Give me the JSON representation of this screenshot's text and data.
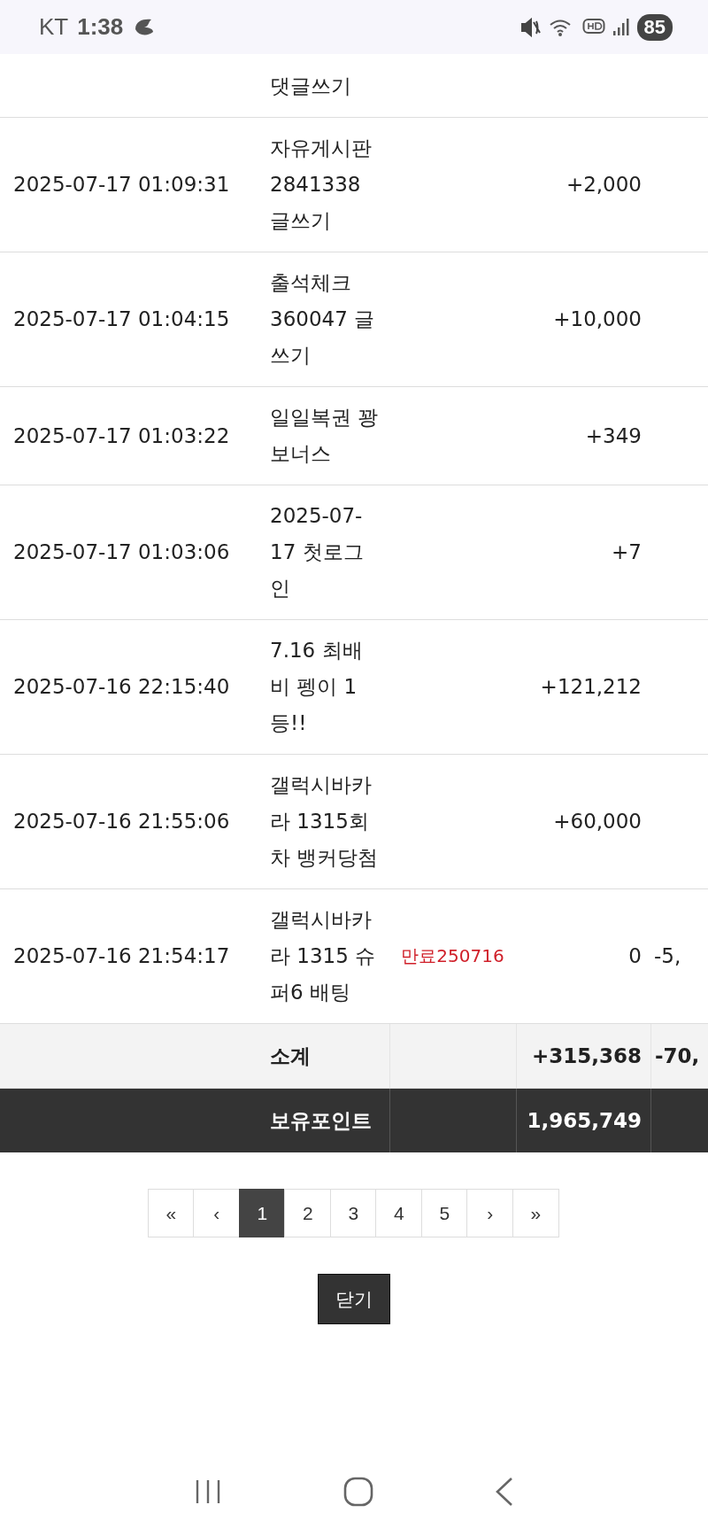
{
  "status_bar": {
    "carrier": "KT",
    "time": "1:38",
    "battery": "85"
  },
  "table": {
    "rows": [
      {
        "date": "",
        "description": "댓글쓰기",
        "memo": "",
        "amount": "",
        "column_5": ""
      },
      {
        "date": "2025-07-17 01:09:31",
        "description": "자유게시판 2841338 글쓰기",
        "memo": "",
        "amount": "+2,000",
        "column_5": ""
      },
      {
        "date": "2025-07-17 01:04:15",
        "description": "출석체크 360047 글쓰기",
        "memo": "",
        "amount": "+10,000",
        "column_5": ""
      },
      {
        "date": "2025-07-17 01:03:22",
        "description": "일일복권 꽝 보너스",
        "memo": "",
        "amount": "+349",
        "column_5": ""
      },
      {
        "date": "2025-07-17 01:03:06",
        "description": "2025-07-17 첫로그인",
        "memo": "",
        "amount": "+7",
        "column_5": ""
      },
      {
        "date": "2025-07-16 22:15:40",
        "description": "7.16 최배비 펭이 1등!!",
        "memo": "",
        "amount": "+121,212",
        "column_5": ""
      },
      {
        "date": "2025-07-16 21:55:06",
        "description": "갤럭시바카라 1315회차 뱅커당첨",
        "memo": "",
        "amount": "+60,000",
        "column_5": ""
      },
      {
        "date": "2025-07-16 21:54:17",
        "description": "갤럭시바카라 1315 슈퍼6 배팅",
        "memo": "만료250716",
        "amount": "0",
        "column_5": "-5,"
      }
    ],
    "subtotal": {
      "label": "소계",
      "amount": "+315,368",
      "column_5": "-70,"
    },
    "balance": {
      "label": "보유포인트",
      "amount": "1,965,749"
    }
  },
  "pagination": [
    {
      "label": "«",
      "selected": false
    },
    {
      "label": "‹",
      "selected": false
    },
    {
      "label": "1",
      "selected": true
    },
    {
      "label": "2",
      "selected": false
    },
    {
      "label": "3",
      "selected": false
    },
    {
      "label": "4",
      "selected": false
    },
    {
      "label": "5",
      "selected": false
    },
    {
      "label": "›",
      "selected": false
    },
    {
      "label": "»",
      "selected": false
    }
  ],
  "close_button": "닫기"
}
